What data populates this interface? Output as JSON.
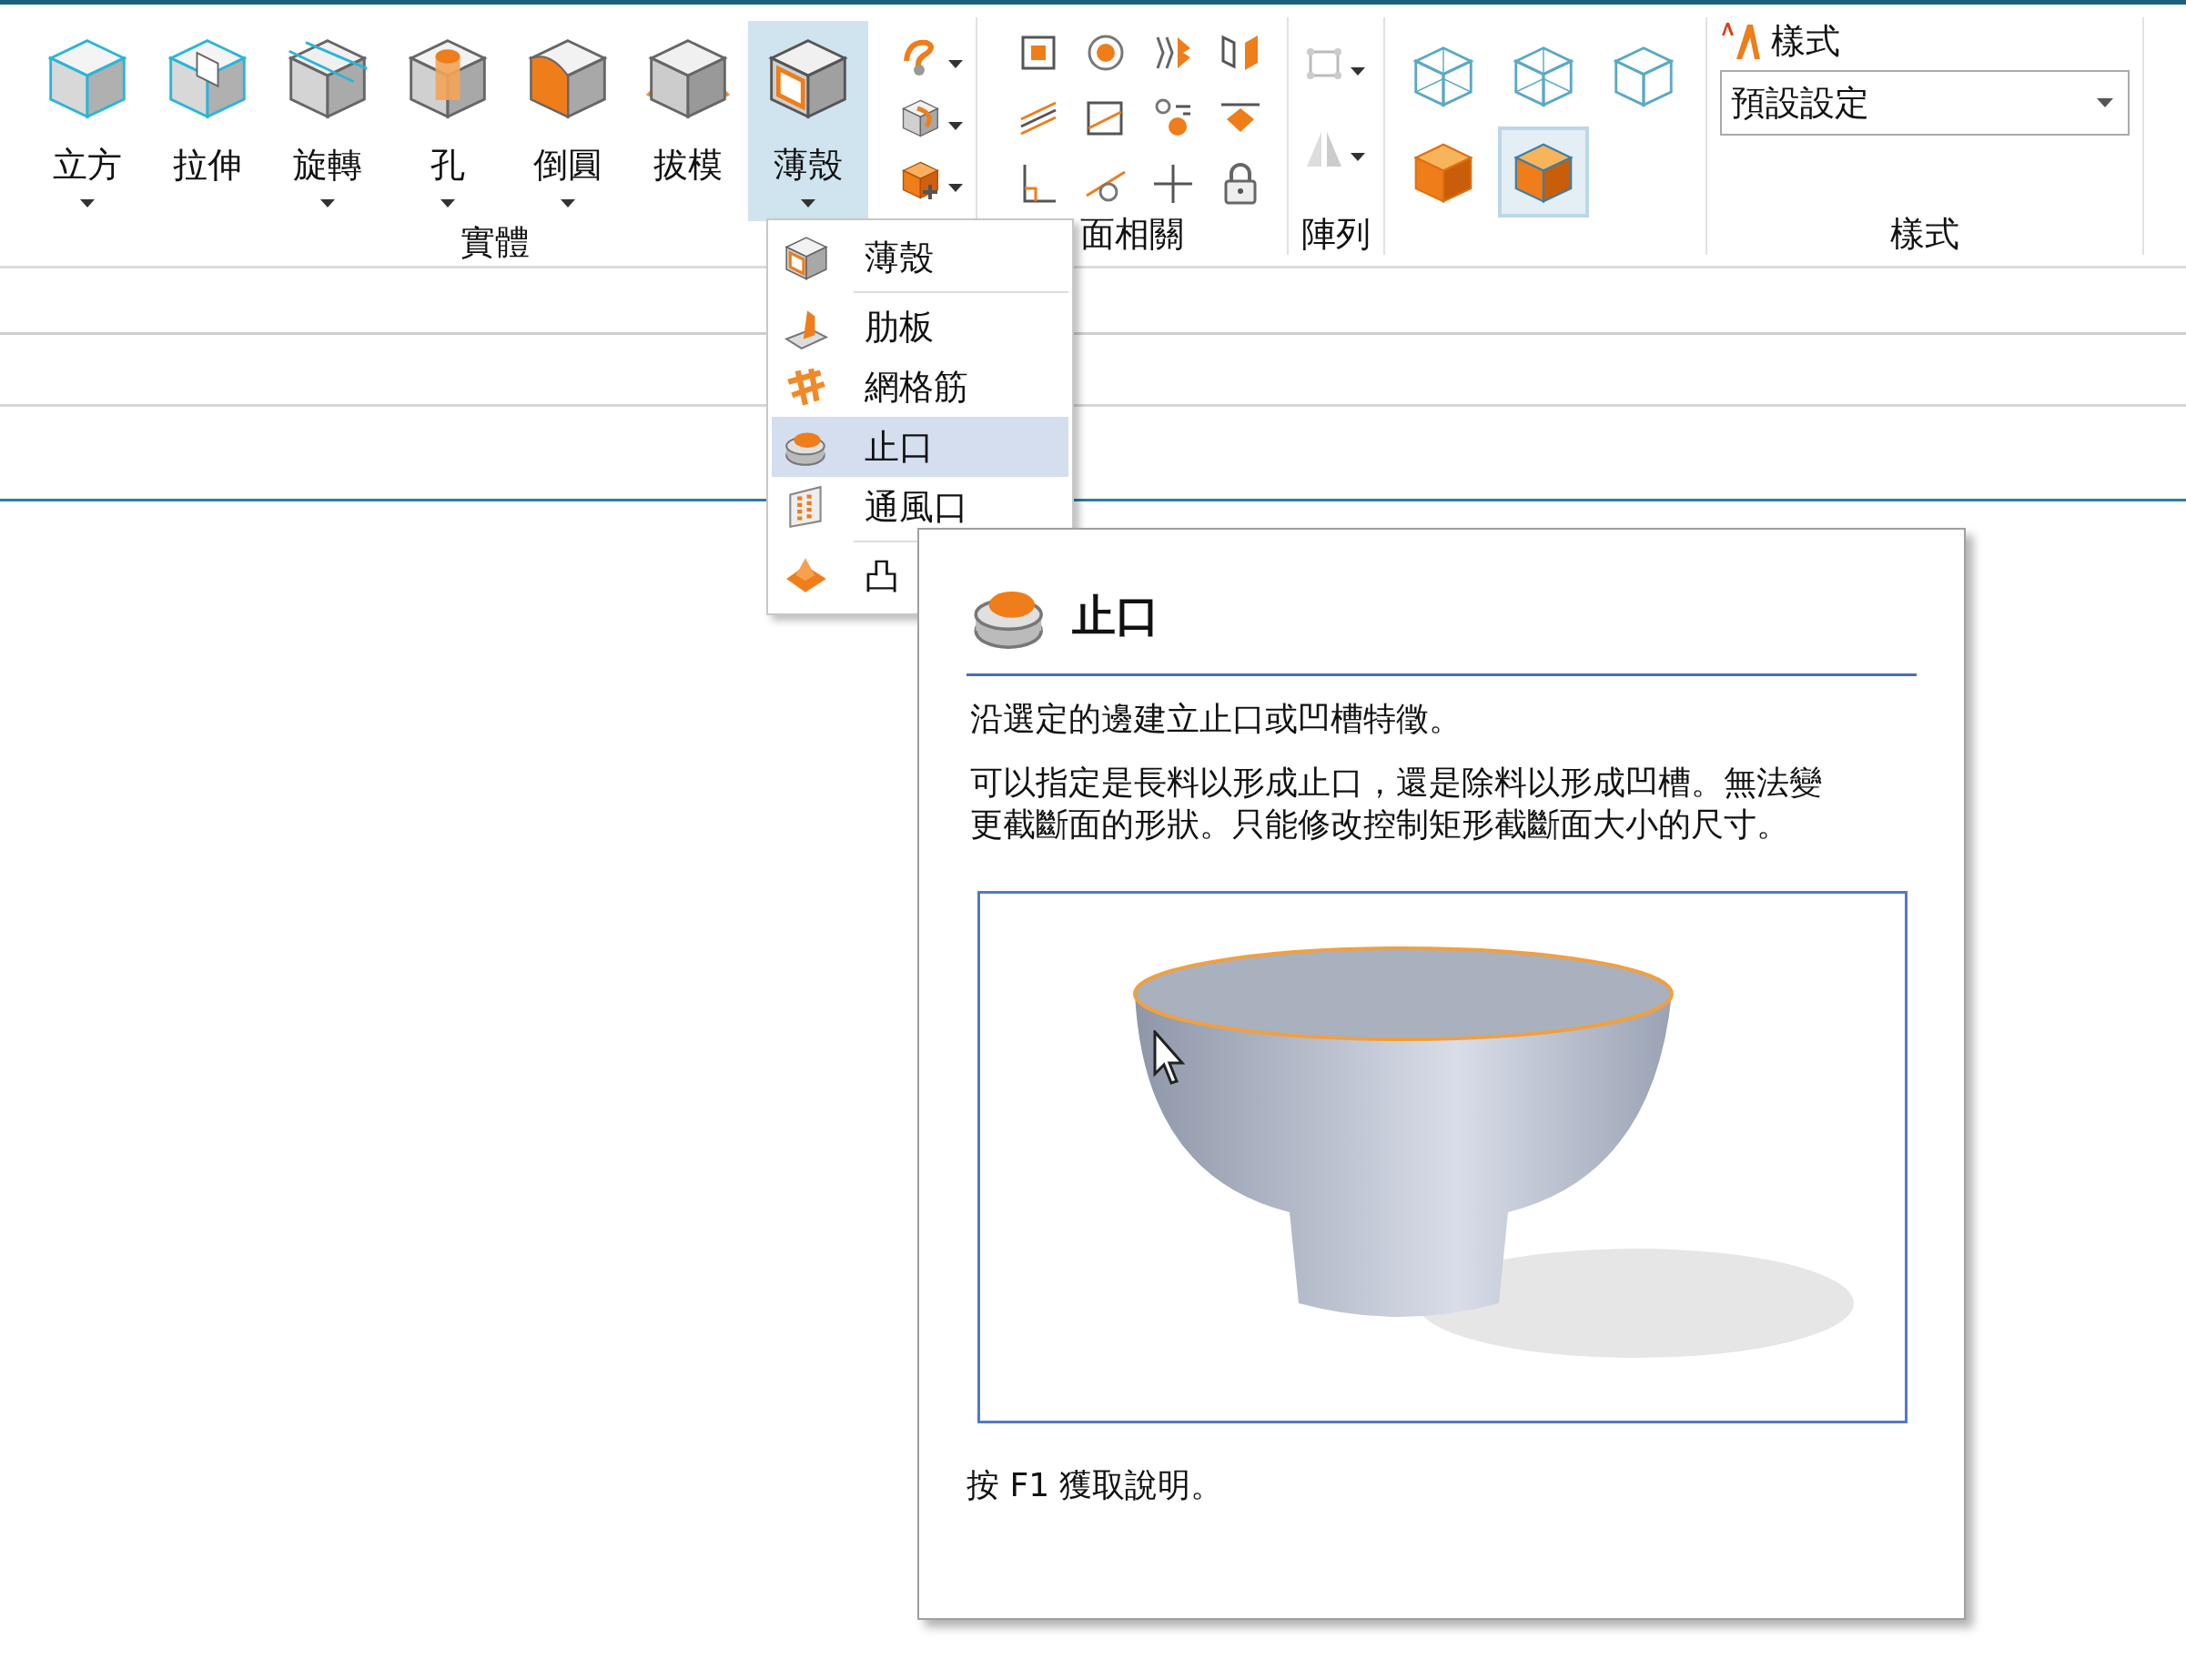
{
  "ribbon": {
    "solid_group": {
      "label": "實體",
      "buttons": [
        {
          "label": "立方",
          "has_dropdown": true,
          "selected": false
        },
        {
          "label": "拉伸",
          "has_dropdown": false,
          "selected": false
        },
        {
          "label": "旋轉",
          "has_dropdown": true,
          "selected": false
        },
        {
          "label": "孔",
          "has_dropdown": true,
          "selected": false
        },
        {
          "label": "倒圓",
          "has_dropdown": true,
          "selected": false
        },
        {
          "label": "拔模",
          "has_dropdown": false,
          "selected": false
        },
        {
          "label": "薄殼",
          "has_dropdown": true,
          "selected": true
        }
      ]
    },
    "face_group": {
      "label": "面相關"
    },
    "pattern_group": {
      "label": "陣列"
    },
    "view_group": {
      "modes": [
        {
          "kind": "wireframe",
          "selected": false
        },
        {
          "kind": "wireframe",
          "selected": false
        },
        {
          "kind": "wireframe",
          "selected": false
        },
        {
          "kind": "shaded",
          "selected": false
        },
        {
          "kind": "shaded",
          "selected": true
        }
      ]
    },
    "style_group": {
      "title": "樣式",
      "dropdown": {
        "value": "預設設定"
      },
      "label": "樣式"
    }
  },
  "shell_menu": {
    "items": [
      {
        "label": "薄殼",
        "selected": false,
        "separator_after": true
      },
      {
        "label": "肋板",
        "selected": false,
        "separator_after": false
      },
      {
        "label": "網格筋",
        "selected": false,
        "separator_after": false
      },
      {
        "label": "止口",
        "selected": true,
        "separator_after": false
      },
      {
        "label": "通風口",
        "selected": false,
        "separator_after": true
      },
      {
        "label": "凸",
        "selected": false,
        "separator_after": false
      }
    ]
  },
  "tooltip": {
    "title": "止口",
    "paragraphs": [
      "沿選定的邊建立止口或凹槽特徵。",
      "可以指定是長料以形成止口，還是除料以形成凹槽。無法變更截斷面的形狀。只能修改控制矩形截斷面大小的尺寸。"
    ],
    "footer": "按 F1 獲取說明。"
  }
}
